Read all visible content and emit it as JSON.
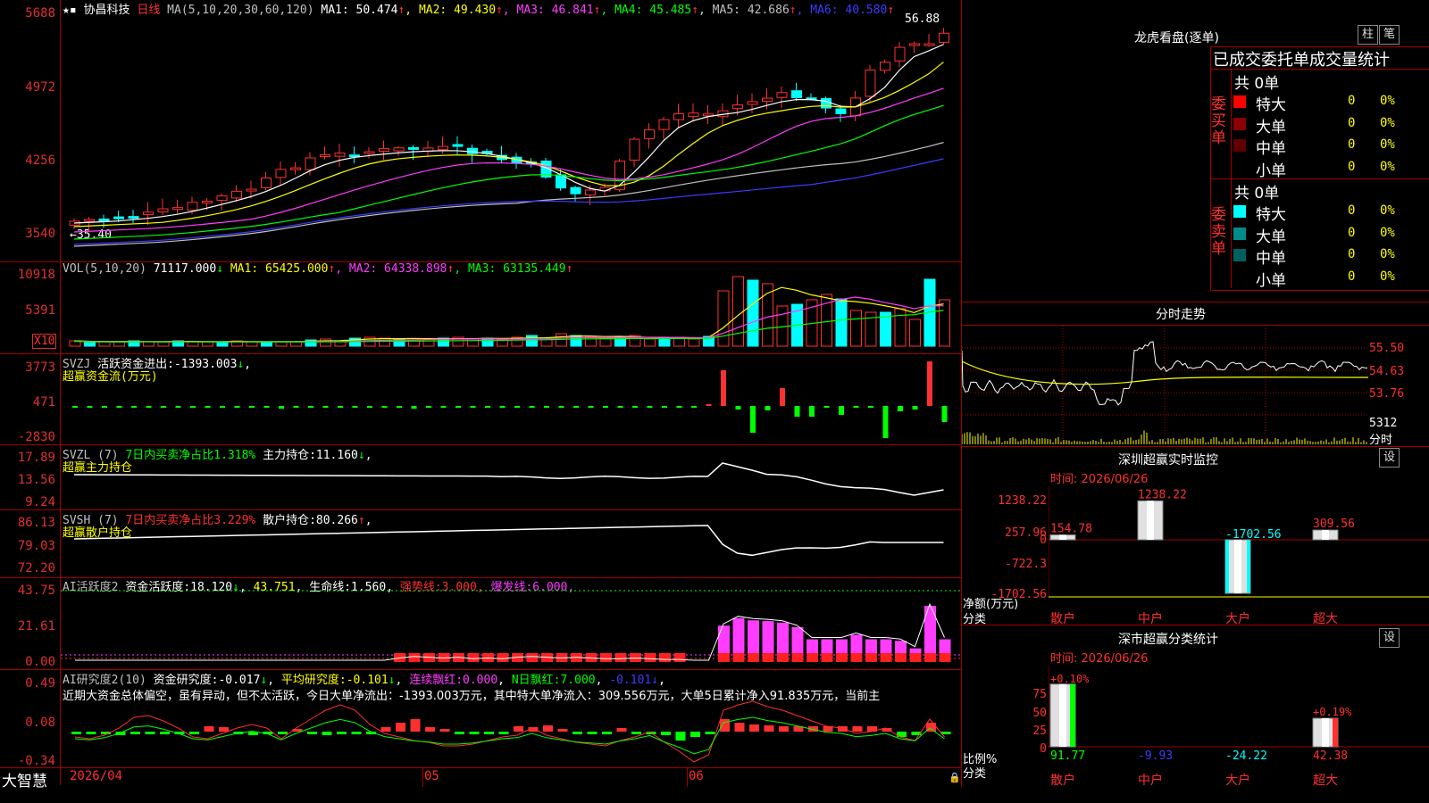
{
  "stock": {
    "name": "协昌科技",
    "period": "日线"
  },
  "main": {
    "ma_params": "MA(5,10,20,30,60,120)",
    "ma": [
      {
        "label": "MA1:",
        "value": "50.474",
        "arrow": "↑",
        "color": "#ffffff"
      },
      {
        "label": "MA2:",
        "value": "49.430",
        "arrow": "↑",
        "color": "#ffff00"
      },
      {
        "label": "MA3:",
        "value": "46.841",
        "arrow": "↑",
        "color": "#ff3cff"
      },
      {
        "label": "MA4:",
        "value": "45.485",
        "arrow": "↑",
        "color": "#00ff00"
      },
      {
        "label": "MA5:",
        "value": "42.686",
        "arrow": "↑",
        "color": "#c0c0c0"
      },
      {
        "label": "MA6:",
        "value": "40.580",
        "arrow": "↑",
        "color": "#3c3cff"
      }
    ],
    "y_labels": [
      "5688",
      "4972",
      "4256",
      "3540"
    ],
    "high_label": "56.88",
    "low_label": "←35.40"
  },
  "vol": {
    "title": "VOL(5,10,20)",
    "value": "71117.000",
    "value_arrow": "↓",
    "ma": [
      {
        "label": "MA1:",
        "value": "65425.000",
        "arrow": "↑",
        "color": "#ffff00"
      },
      {
        "label": "MA2:",
        "value": "64338.898",
        "arrow": "↑",
        "color": "#ff3cff"
      },
      {
        "label": "MA3:",
        "value": "63135.449",
        "arrow": "↑",
        "color": "#00ff00"
      }
    ],
    "y_labels": [
      "10918",
      "5391"
    ],
    "unit": "X10"
  },
  "svzj": {
    "name": "SVZJ",
    "label": "活跃资金进出:",
    "value": "-1393.003",
    "arrow": "↓",
    "subtitle": "超赢资金流(万元)",
    "y_labels": [
      "3773",
      "471",
      "-2830"
    ]
  },
  "svzl": {
    "name": "SVZL  (7)",
    "ratio": "7日内买卖净占比1.318%",
    "label": "主力持仓:",
    "value": "11.160",
    "arrow": "↓",
    "subtitle": "超赢主力持仓",
    "y_labels": [
      "17.89",
      "13.56",
      "9.24"
    ]
  },
  "svsh": {
    "name": "SVSH  (7)",
    "ratio": "7日内买卖净占比3.229%",
    "label": "散户持仓:",
    "value": "80.266",
    "arrow": "↑",
    "subtitle": "超赢散户持仓",
    "y_labels": [
      "86.13",
      "79.03",
      "72.20"
    ]
  },
  "ai_active": {
    "title": "AI活跃度2",
    "label": "资金活跃度:",
    "value": "18.120",
    "arrow": "↓",
    "value2": "43.751",
    "life_label": "生命线:",
    "life_value": "1.560",
    "strong_label": "强势线:",
    "strong_value": "3.000",
    "burst_label": "爆发线:",
    "burst_value": "6.000",
    "y_labels": [
      "43.75",
      "21.61",
      "0.00"
    ]
  },
  "ai_research": {
    "title": "AI研究度2(10)",
    "label": "资金研究度:",
    "value": "-0.017",
    "arrow": "↓",
    "avg_label": "平均研究度:",
    "avg_value": "-0.101",
    "red_label": "连续飘红:",
    "red_value": "0.000",
    "n_label": "N日飘红:",
    "n_value": "7.000",
    "last_value": "-0.101",
    "comment": "近期大资金总体偏空，虽有异动，但不太活跃，今日大单净流出：-1393.003万元，其中特大单净流入：309.556万元，大单5日累计净入91.835万元，当前主",
    "y_labels": [
      "0.49",
      "0.08",
      "-0.34"
    ]
  },
  "bottom": {
    "brand": "大智慧",
    "dates": [
      "2026/04",
      "05",
      "06"
    ]
  },
  "right": {
    "header_title": "龙虎看盘(逐单)",
    "btn_bar": "柱",
    "btn_pen": "笔",
    "stats_title": "已成交委托单成交量统计",
    "buy_side": "委买单",
    "sell_side": "委卖单",
    "buy_total": "共 0单",
    "sell_total": "共 0单",
    "rows": [
      {
        "label": "特大",
        "count": "0",
        "pct": "0%",
        "color": "#ff0000"
      },
      {
        "label": "大单",
        "count": "0",
        "pct": "0%",
        "color": "#8b0000"
      },
      {
        "label": "中单",
        "count": "0",
        "pct": "0%",
        "color": "#600000"
      },
      {
        "label": "小单",
        "count": "0",
        "pct": "0%",
        "color": "#000000"
      }
    ],
    "sell_rows": [
      {
        "label": "特大",
        "count": "0",
        "pct": "0%",
        "color": "#00ffff"
      },
      {
        "label": "大单",
        "count": "0",
        "pct": "0%",
        "color": "#008b8b"
      },
      {
        "label": "中单",
        "count": "0",
        "pct": "0%",
        "color": "#006060"
      },
      {
        "label": "小单",
        "count": "0",
        "pct": "0%",
        "color": "#000000"
      }
    ],
    "intraday_title": "分时走势",
    "intraday_labels": [
      "55.50",
      "54.63",
      "53.76",
      "5312",
      "分时"
    ],
    "monitor_title": "深圳超赢实时监控",
    "monitor_btn": "设",
    "monitor_time": "时间: 2026/06/26",
    "monitor_y": [
      "1238.22",
      "257.96",
      "0",
      "-722.3",
      "-1702.56"
    ],
    "monitor_axis_title": "净额(万元)",
    "monitor_axis_sub": "分类",
    "monitor_values": [
      "154.78",
      "1238.22",
      "-1702.56",
      "309.56"
    ],
    "categories": [
      "散户",
      "中户",
      "大户",
      "超大"
    ],
    "classify_title": "深市超赢分类统计",
    "classify_btn": "设",
    "classify_time": "时间: 2026/06/26",
    "classify_y": [
      "75",
      "50",
      "25",
      "0"
    ],
    "classify_top": [
      "+0.10%",
      "+0.19%"
    ],
    "classify_axis_title": "比例%",
    "classify_axis_sub": "分类",
    "classify_values": [
      "91.77",
      "-9.93",
      "-24.22",
      "42.38"
    ]
  }
}
